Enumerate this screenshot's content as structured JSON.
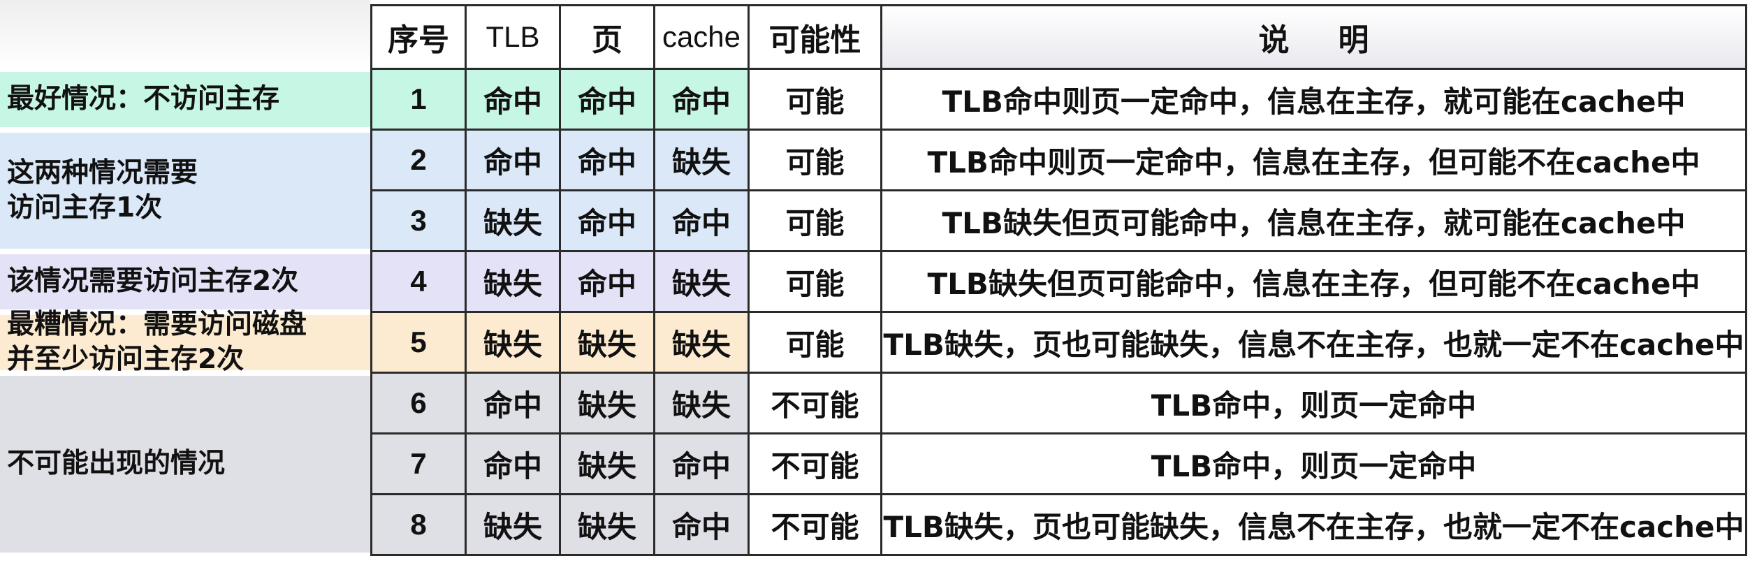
{
  "colors": {
    "best": "#c6f7e4",
    "once": "#dbe8f8",
    "twice": "#e4e2f7",
    "worst": "#fcebd0",
    "impossible": "#dfdfe6"
  },
  "table": {
    "headers": [
      "序号",
      "TLB",
      "页",
      "cache",
      "可能性",
      "说明"
    ],
    "rows": [
      {
        "seq": "1",
        "tlb": "命中",
        "page": "命中",
        "cache": "命中",
        "possibility": "可能",
        "explanation": "TLB命中则页一定命中，信息在主存，就可能在cache中"
      },
      {
        "seq": "2",
        "tlb": "命中",
        "page": "命中",
        "cache": "缺失",
        "possibility": "可能",
        "explanation": "TLB命中则页一定命中，信息在主存，但可能不在cache中"
      },
      {
        "seq": "3",
        "tlb": "缺失",
        "page": "命中",
        "cache": "命中",
        "possibility": "可能",
        "explanation": "TLB缺失但页可能命中，信息在主存，就可能在cache中"
      },
      {
        "seq": "4",
        "tlb": "缺失",
        "page": "命中",
        "cache": "缺失",
        "possibility": "可能",
        "explanation": "TLB缺失但页可能命中，信息在主存，但可能不在cache中"
      },
      {
        "seq": "5",
        "tlb": "缺失",
        "page": "缺失",
        "cache": "缺失",
        "possibility": "可能",
        "explanation": "TLB缺失，页也可能缺失，信息不在主存，也就一定不在cache中"
      },
      {
        "seq": "6",
        "tlb": "命中",
        "page": "缺失",
        "cache": "缺失",
        "possibility": "不可能",
        "explanation": "TLB命中，则页一定命中"
      },
      {
        "seq": "7",
        "tlb": "命中",
        "page": "缺失",
        "cache": "命中",
        "possibility": "不可能",
        "explanation": "TLB命中，则页一定命中"
      },
      {
        "seq": "8",
        "tlb": "缺失",
        "page": "缺失",
        "cache": "命中",
        "possibility": "不可能",
        "explanation": "TLB缺失，页也可能缺失，信息不在主存，也就一定不在cache中"
      }
    ]
  },
  "groups": {
    "best": {
      "line1": "最好情况：不访问主存",
      "line2": ""
    },
    "once": {
      "line1": "这两种情况需要",
      "line2": "访问主存1次"
    },
    "twice": {
      "line1": "该情况需要访问主存2次",
      "line2": ""
    },
    "worst": {
      "line1": "最糟情况：需要访问磁盘",
      "line2": "并至少访问主存2次"
    },
    "impossible": {
      "line1": "不可能出现的情况",
      "line2": ""
    }
  }
}
